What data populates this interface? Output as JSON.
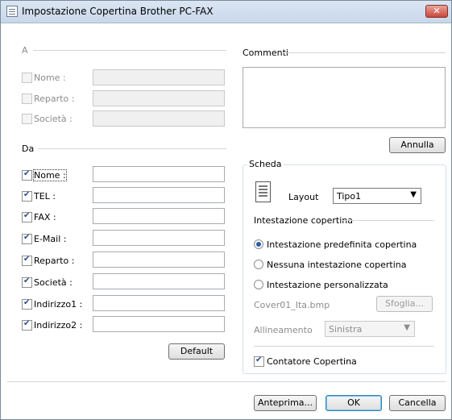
{
  "window": {
    "title": "Impostazione Copertina Brother PC-FAX",
    "close_glyph": "✕"
  },
  "a_section": {
    "label": "A",
    "fields": [
      {
        "label": "Nome :",
        "checked": false,
        "enabled": false
      },
      {
        "label": "Reparto :",
        "checked": false,
        "enabled": false
      },
      {
        "label": "Società :",
        "checked": false,
        "enabled": false
      }
    ]
  },
  "da_section": {
    "label": "Da",
    "fields": [
      {
        "label": "Nome :",
        "checked": true
      },
      {
        "label": "TEL :",
        "checked": true
      },
      {
        "label": "FAX :",
        "checked": true
      },
      {
        "label": "E-Mail :",
        "checked": true
      },
      {
        "label": "Reparto :",
        "checked": true
      },
      {
        "label": "Società :",
        "checked": true
      },
      {
        "label": "Indirizzo1 :",
        "checked": true
      },
      {
        "label": "Indirizzo2 :",
        "checked": true
      }
    ],
    "default_button": "Default"
  },
  "commenti": {
    "label": "Commenti",
    "value": "",
    "annulla_button": "Annulla"
  },
  "scheda": {
    "label": "Scheda",
    "layout_label": "Layout",
    "layout_value": "Tipo1",
    "intestazione_label": "Intestazione copertina",
    "options": [
      {
        "label": "Intestazione predefinita copertina",
        "selected": true
      },
      {
        "label": "Nessuna intestazione copertina",
        "selected": false
      },
      {
        "label": "Intestazione personalizzata",
        "selected": false
      }
    ],
    "file_name": "Cover01_Ita.bmp",
    "sfoglia_button": "Sfoglia...",
    "allineamento_label": "Allineamento",
    "allineamento_value": "Sinistra",
    "contatore_label": "Contatore Copertina",
    "contatore_checked": true
  },
  "footer": {
    "anteprima": "Anteprima...",
    "ok": "OK",
    "cancella": "Cancella"
  }
}
